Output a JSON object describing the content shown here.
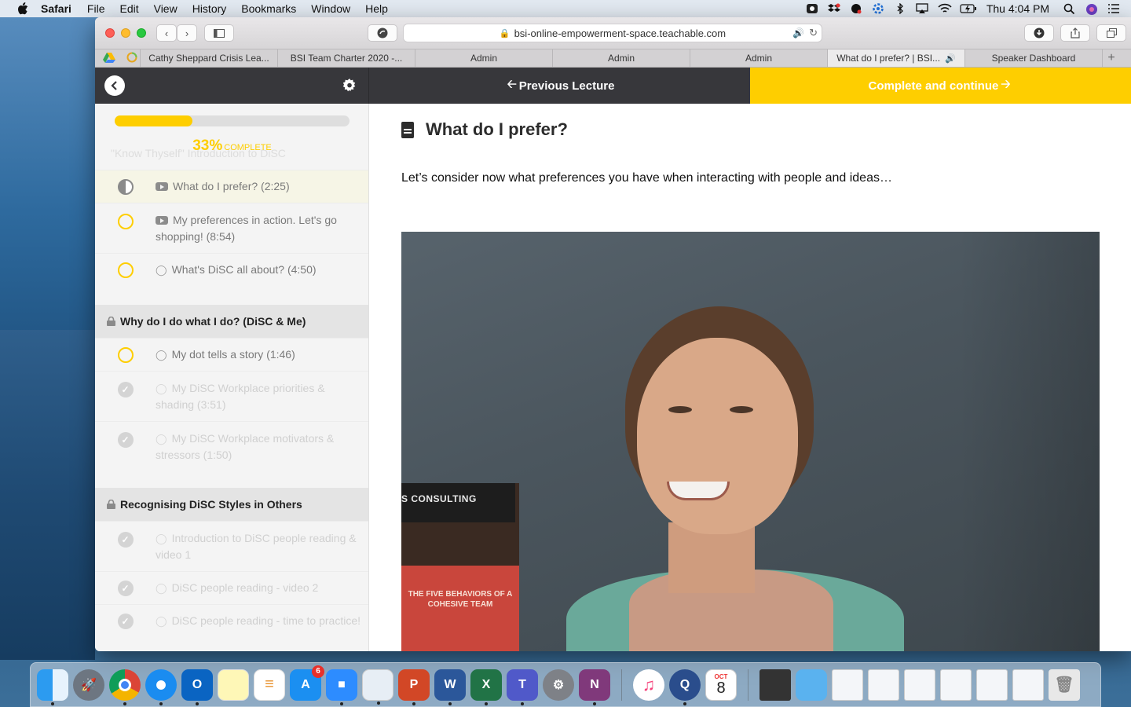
{
  "menubar": {
    "app_name": "Safari",
    "items": [
      "File",
      "Edit",
      "View",
      "History",
      "Bookmarks",
      "Window",
      "Help"
    ],
    "clock": "Thu 4:04 PM"
  },
  "browser": {
    "url": "bsi-online-empowerment-space.teachable.com",
    "tabs": [
      {
        "label": "Cathy Sheppard Crisis Lea..."
      },
      {
        "label": "BSI Team Charter 2020 -..."
      },
      {
        "label": "Admin"
      },
      {
        "label": "Admin"
      },
      {
        "label": "Admin"
      },
      {
        "label": "What do I prefer? | BSI..."
      },
      {
        "label": "Speaker Dashboard"
      }
    ],
    "new_tab": "+"
  },
  "course_header": {
    "prev_label": "Previous Lecture",
    "next_label": "Complete and continue"
  },
  "sidebar": {
    "progress_percent": 33,
    "progress_pct_text": "33%",
    "progress_word": "COMPLETE",
    "faded_section_title": "\"Know Thyself\" Introduction to DiSC",
    "lessons_section1": [
      {
        "label": "What do I prefer? (2:25)"
      },
      {
        "label": "My preferences in action. Let's go shopping! (8:54)"
      },
      {
        "label": "What's DiSC all about? (4:50)"
      }
    ],
    "section2_title": "Why do I do what I do? (DiSC & Me)",
    "lessons_section2": [
      {
        "label": "My dot tells a story (1:46)"
      },
      {
        "label": "My DiSC Workplace priorities & shading (3:51)"
      },
      {
        "label": "My DiSC Workplace motivators & stressors (1:50)"
      }
    ],
    "section3_title": "Recognising DiSC Styles in Others",
    "lessons_section3": [
      {
        "label": "Introduction to DiSC people reading & video 1"
      },
      {
        "label": "DiSC people reading - video 2"
      },
      {
        "label": "DiSC people reading - time to practice!"
      }
    ]
  },
  "main": {
    "lecture_title": "What do I prefer?",
    "lecture_text": "Let’s consider now what preferences you have when interacting with people and ideas…",
    "video_book_spine": "S CONSULTING",
    "video_book_title": "THE FIVE BEHAVIORS OF A COHESIVE TEAM"
  },
  "dock": {
    "items": [
      "finder-icon",
      "launchpad-icon",
      "chrome-icon",
      "safari-icon",
      "outlook-icon",
      "notes-icon",
      "reminders-icon",
      "app-store-icon",
      "zoom-icon",
      "preview-icon",
      "powerpoint-icon",
      "word-icon",
      "excel-icon",
      "teams-icon",
      "system-preferences-icon",
      "onenote-icon",
      "itunes-icon",
      "quicktime-icon",
      "calendar-icon"
    ],
    "app_store_badge": "6",
    "calendar_month": "OCT",
    "calendar_day": "8"
  }
}
